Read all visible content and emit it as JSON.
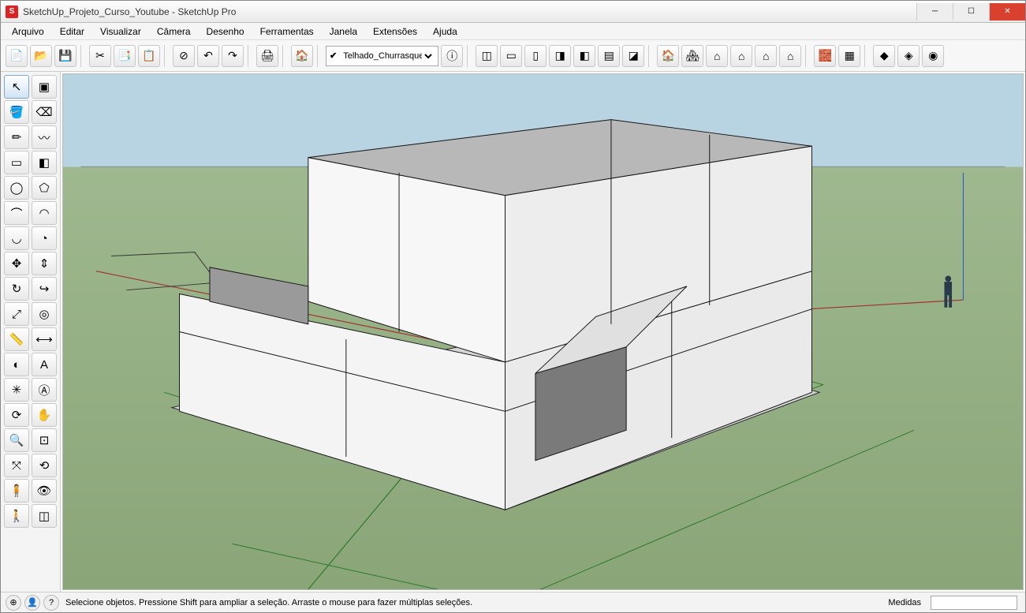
{
  "titlebar": {
    "title": "SketchUp_Projeto_Curso_Youtube - SketchUp Pro"
  },
  "menu": {
    "items": [
      "Arquivo",
      "Editar",
      "Visualizar",
      "Câmera",
      "Desenho",
      "Ferramentas",
      "Janela",
      "Extensões",
      "Ajuda"
    ]
  },
  "toolbar_top": {
    "layer_selected": "Telhado_Churrasque",
    "buttons": [
      {
        "n": "new-file-icon",
        "g": "📄"
      },
      {
        "n": "open-file-icon",
        "g": "📂"
      },
      {
        "n": "save-icon",
        "g": "💾"
      },
      {
        "sep": true
      },
      {
        "n": "cut-icon",
        "g": "✂"
      },
      {
        "n": "copy-icon",
        "g": "📑"
      },
      {
        "n": "paste-icon",
        "g": "📋"
      },
      {
        "sep": true
      },
      {
        "n": "cancel-icon",
        "g": "⊘"
      },
      {
        "n": "undo-icon",
        "g": "↶"
      },
      {
        "n": "redo-icon",
        "g": "↷"
      },
      {
        "sep": true
      },
      {
        "n": "print-icon",
        "g": "🖨"
      },
      {
        "sep": true
      },
      {
        "n": "model-info-icon",
        "g": "🏠"
      },
      {
        "sep": true
      },
      {
        "layer": true
      },
      {
        "n": "layer-info-icon",
        "g": "ⓘ"
      },
      {
        "sep": true
      },
      {
        "n": "iso-icon",
        "g": "◫"
      },
      {
        "n": "top-icon",
        "g": "▭"
      },
      {
        "n": "front-icon",
        "g": "▯"
      },
      {
        "n": "right-icon",
        "g": "◨"
      },
      {
        "n": "back-icon",
        "g": "◧"
      },
      {
        "n": "left-icon",
        "g": "▤"
      },
      {
        "n": "shade-icon",
        "g": "◪"
      },
      {
        "sep": true
      },
      {
        "n": "style1-icon",
        "g": "🏠"
      },
      {
        "n": "style2-icon",
        "g": "🏘"
      },
      {
        "n": "style3-icon",
        "g": "⌂"
      },
      {
        "n": "style4-icon",
        "g": "⌂"
      },
      {
        "n": "style5-icon",
        "g": "⌂"
      },
      {
        "n": "style6-icon",
        "g": "⌂"
      },
      {
        "sep": true
      },
      {
        "n": "ext1-icon",
        "g": "🧱"
      },
      {
        "n": "ext2-icon",
        "g": "▦"
      },
      {
        "sep": true
      },
      {
        "n": "ext3-icon",
        "g": "◆"
      },
      {
        "n": "ext4-icon",
        "g": "◈"
      },
      {
        "n": "ext5-icon",
        "g": "◉"
      }
    ]
  },
  "tools_left": [
    [
      {
        "n": "select-tool",
        "g": "↖",
        "sel": true
      },
      {
        "n": "component-tool",
        "g": "▣"
      }
    ],
    [
      {
        "n": "paint-bucket-tool",
        "g": "🪣"
      },
      {
        "n": "eraser-tool",
        "g": "⌫"
      }
    ],
    [
      {
        "n": "pencil-tool",
        "g": "✏"
      },
      {
        "n": "freehand-tool",
        "g": "〰"
      }
    ],
    [
      {
        "n": "rectangle-tool",
        "g": "▭"
      },
      {
        "n": "rotated-rect-tool",
        "g": "◧"
      }
    ],
    [
      {
        "n": "circle-tool",
        "g": "◯"
      },
      {
        "n": "polygon-tool",
        "g": "⬠"
      }
    ],
    [
      {
        "n": "arc-tool",
        "g": "⌒"
      },
      {
        "n": "arc2-tool",
        "g": "◠"
      }
    ],
    [
      {
        "n": "arc3-tool",
        "g": "◡"
      },
      {
        "n": "pie-tool",
        "g": "◔"
      }
    ],
    [
      {
        "n": "move-tool",
        "g": "✥"
      },
      {
        "n": "pushpull-tool",
        "g": "⇕"
      }
    ],
    [
      {
        "n": "rotate-tool",
        "g": "↻"
      },
      {
        "n": "followme-tool",
        "g": "↪"
      }
    ],
    [
      {
        "n": "scale-tool",
        "g": "⤢"
      },
      {
        "n": "offset-tool",
        "g": "◎"
      }
    ],
    [
      {
        "n": "tape-tool",
        "g": "📏"
      },
      {
        "n": "dimension-tool",
        "g": "⟷"
      }
    ],
    [
      {
        "n": "protractor-tool",
        "g": "◐"
      },
      {
        "n": "text-tool",
        "g": "A"
      }
    ],
    [
      {
        "n": "axes-tool",
        "g": "✳"
      },
      {
        "n": "3dtext-tool",
        "g": "Ⓐ"
      }
    ],
    [
      {
        "n": "orbit-tool",
        "g": "⟳"
      },
      {
        "n": "pan-tool",
        "g": "✋"
      }
    ],
    [
      {
        "n": "zoom-tool",
        "g": "🔍"
      },
      {
        "n": "zoom-window-tool",
        "g": "⊡"
      }
    ],
    [
      {
        "n": "zoom-extents-tool",
        "g": "⤧"
      },
      {
        "n": "previous-tool",
        "g": "⟲"
      }
    ],
    [
      {
        "n": "position-camera-tool",
        "g": "🧍"
      },
      {
        "n": "look-around-tool",
        "g": "👁"
      }
    ],
    [
      {
        "n": "walk-tool",
        "g": "🚶"
      },
      {
        "n": "section-tool",
        "g": "◫"
      }
    ]
  ],
  "status": {
    "hint": "Selecione objetos. Pressione Shift para ampliar a seleção. Arraste o mouse para fazer múltiplas seleções.",
    "measure_label": "Medidas",
    "buttons": [
      {
        "n": "geo-icon",
        "g": "⊕"
      },
      {
        "n": "credits-icon",
        "g": "👤"
      },
      {
        "n": "help-icon",
        "g": "?"
      }
    ]
  }
}
